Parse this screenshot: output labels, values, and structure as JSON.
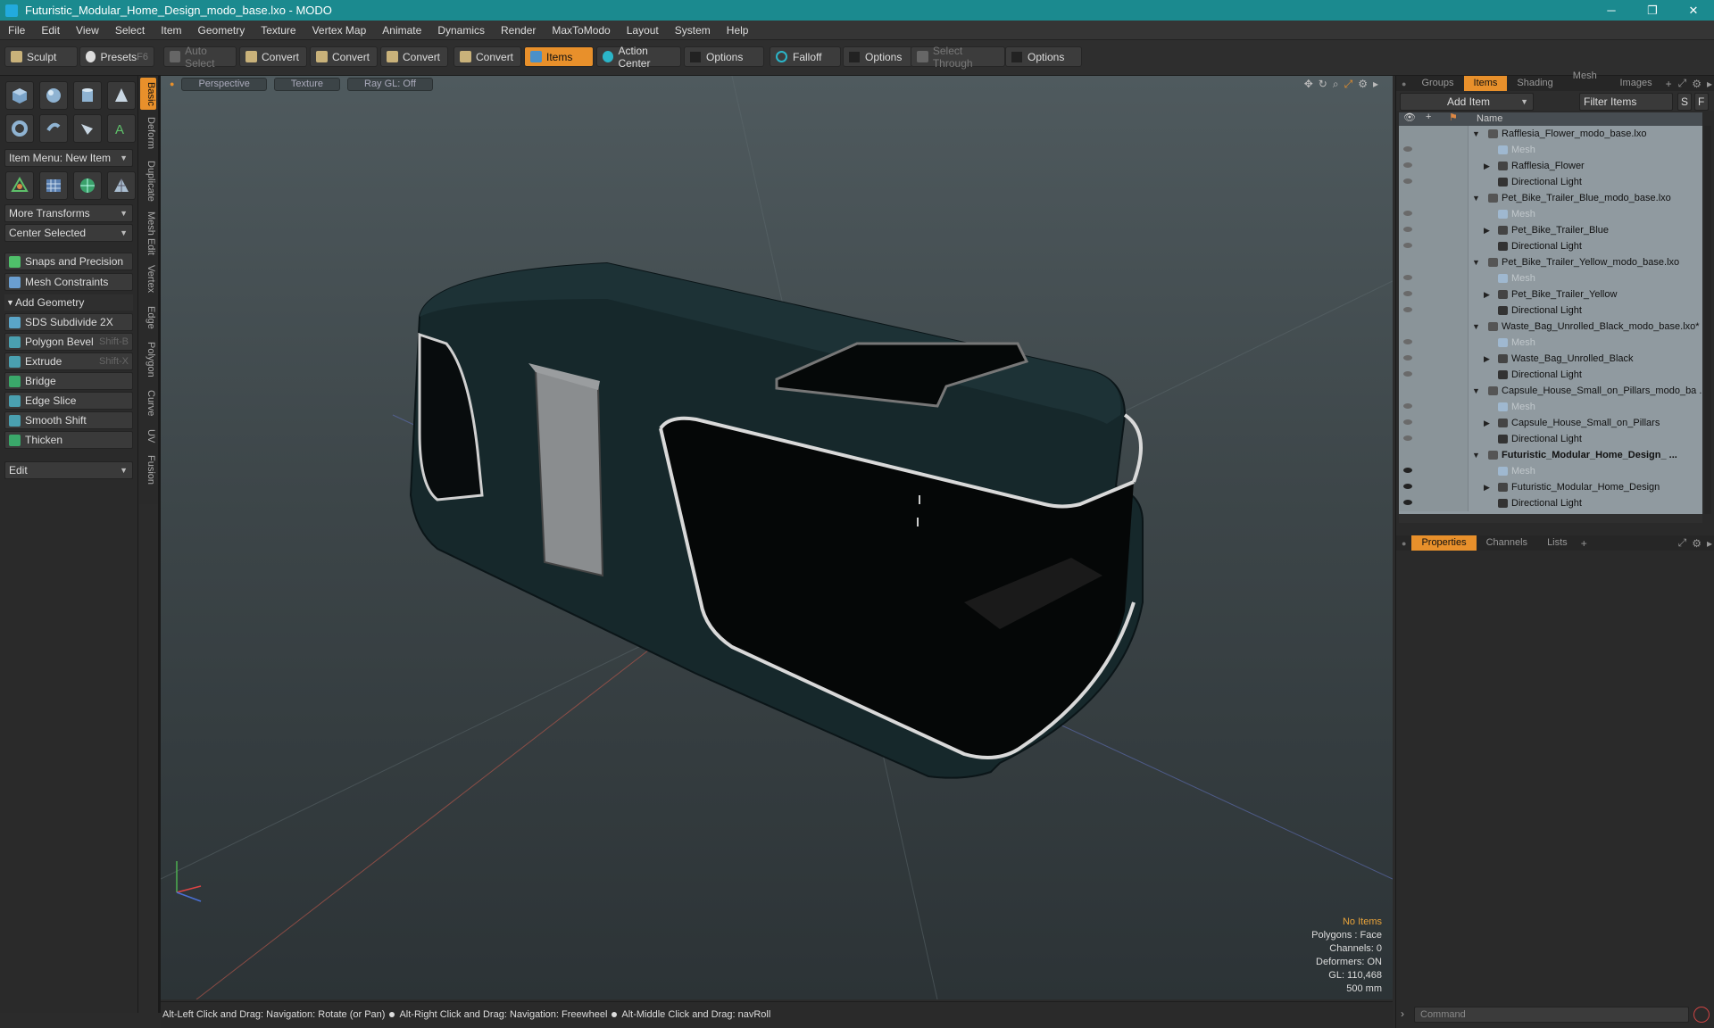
{
  "window": {
    "title": "Futuristic_Modular_Home_Design_modo_base.lxo - MODO"
  },
  "menu": [
    "File",
    "Edit",
    "View",
    "Select",
    "Item",
    "Geometry",
    "Texture",
    "Vertex Map",
    "Animate",
    "Dynamics",
    "Render",
    "MaxToModo",
    "Layout",
    "System",
    "Help"
  ],
  "toolbar": {
    "sculpt": "Sculpt",
    "presets": "Presets",
    "presets_key": "F6",
    "auto_select": "Auto Select",
    "convert": "Convert",
    "items": "Items",
    "action_center": "Action Center",
    "options": "Options",
    "falloff": "Falloff",
    "select_through": "Select Through"
  },
  "left": {
    "item_menu": "Item Menu: New Item",
    "more_transforms": "More Transforms",
    "center_selected": "Center Selected",
    "snaps": "Snaps and Precision",
    "mesh_constraints": "Mesh Constraints",
    "add_geometry": "Add Geometry",
    "tools": [
      {
        "label": "SDS Subdivide 2X",
        "key": ""
      },
      {
        "label": "Polygon Bevel",
        "key": "Shift-B"
      },
      {
        "label": "Extrude",
        "key": "Shift-X"
      },
      {
        "label": "Bridge",
        "key": ""
      },
      {
        "label": "Edge Slice",
        "key": ""
      },
      {
        "label": "Smooth Shift",
        "key": ""
      },
      {
        "label": "Thicken",
        "key": ""
      }
    ],
    "edit": "Edit",
    "vtabs": [
      "Basic",
      "Deform",
      "Duplicate",
      "Mesh Edit",
      "Vertex",
      "Edge",
      "Polygon",
      "Curve",
      "UV",
      "Fusion"
    ]
  },
  "viewport": {
    "perspective": "Perspective",
    "texture": "Texture",
    "raygl": "Ray GL: Off",
    "info": {
      "no_items": "No Items",
      "polygons": "Polygons : Face",
      "channels": "Channels: 0",
      "deformers": "Deformers: ON",
      "gl": "GL: 110,468",
      "scale": "500 mm"
    }
  },
  "status": {
    "hint1": "Alt-Left Click and Drag: Navigation: Rotate (or Pan)",
    "hint2": "Alt-Right Click and Drag: Navigation: Freewheel",
    "hint3": "Alt-Middle Click and Drag: navRoll"
  },
  "right": {
    "tabs": [
      "Groups",
      "Items",
      "Shading",
      "Mesh ...",
      "Images"
    ],
    "add_item": "Add Item",
    "filter_items": "Filter Items",
    "s_btn": "S",
    "f_btn": "F",
    "name_header": "Name",
    "items": [
      {
        "type": "scene",
        "label": "Rafflesia_Flower_modo_base.lxo"
      },
      {
        "type": "mesh",
        "label": "Mesh"
      },
      {
        "type": "group",
        "label": "Rafflesia_Flower"
      },
      {
        "type": "light",
        "label": "Directional Light"
      },
      {
        "type": "scene",
        "label": "Pet_Bike_Trailer_Blue_modo_base.lxo"
      },
      {
        "type": "mesh",
        "label": "Mesh"
      },
      {
        "type": "group",
        "label": "Pet_Bike_Trailer_Blue"
      },
      {
        "type": "light",
        "label": "Directional Light"
      },
      {
        "type": "scene",
        "label": "Pet_Bike_Trailer_Yellow_modo_base.lxo"
      },
      {
        "type": "mesh",
        "label": "Mesh"
      },
      {
        "type": "group",
        "label": "Pet_Bike_Trailer_Yellow"
      },
      {
        "type": "light",
        "label": "Directional Light"
      },
      {
        "type": "scene",
        "label": "Waste_Bag_Unrolled_Black_modo_base.lxo*"
      },
      {
        "type": "mesh",
        "label": "Mesh"
      },
      {
        "type": "group",
        "label": "Waste_Bag_Unrolled_Black"
      },
      {
        "type": "light",
        "label": "Directional Light"
      },
      {
        "type": "scene",
        "label": "Capsule_House_Small_on_Pillars_modo_ba ..."
      },
      {
        "type": "mesh",
        "label": "Mesh"
      },
      {
        "type": "group",
        "label": "Capsule_House_Small_on_Pillars"
      },
      {
        "type": "light",
        "label": "Directional Light"
      },
      {
        "type": "scene",
        "label": "Futuristic_Modular_Home_Design_ ...",
        "bold": true
      },
      {
        "type": "mesh",
        "label": "Mesh"
      },
      {
        "type": "group",
        "label": "Futuristic_Modular_Home_Design"
      },
      {
        "type": "light",
        "label": "Directional Light"
      }
    ],
    "prop_tabs": [
      "Properties",
      "Channels",
      "Lists"
    ],
    "command_placeholder": "Command"
  },
  "colors": {
    "accent": "#e8902b",
    "title_bar": "#1b8a8f",
    "list_bg": "#909aa0"
  }
}
